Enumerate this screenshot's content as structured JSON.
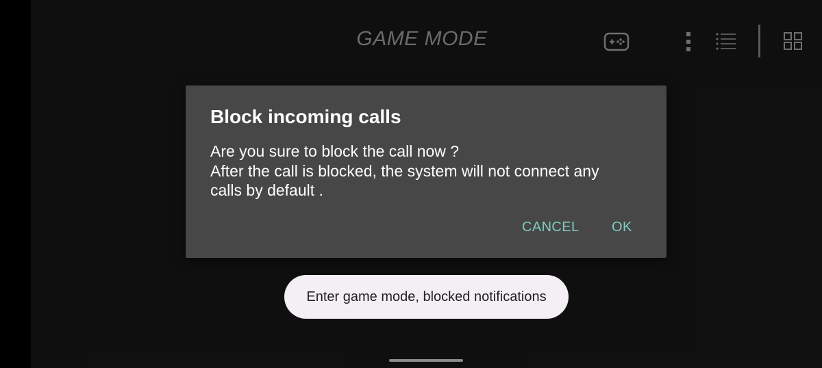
{
  "header": {
    "title": "GAME MODE"
  },
  "toolbar": {
    "icons": [
      "gamepad-icon",
      "more-vert-icon",
      "list-icon",
      "grid-icon"
    ]
  },
  "dialog": {
    "title": "Block incoming calls",
    "message_lines": [
      "Are you sure to block the call now ?",
      "After the call is blocked, the system will not connect any",
      "calls by default ."
    ],
    "cancel_label": "CANCEL",
    "ok_label": "OK"
  },
  "toast": {
    "text": "Enter game mode, blocked notifications"
  },
  "colors": {
    "dialog_background": "#474747",
    "accent": "#7fcdbd",
    "toast_background": "#f4eff4",
    "app_background": "#121212"
  }
}
